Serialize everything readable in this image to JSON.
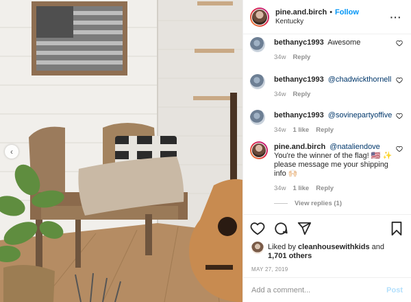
{
  "header": {
    "username": "pine.and.birch",
    "separator": "•",
    "follow_label": "Follow",
    "location": "Kentucky",
    "more_icon": "more-horizontal-icon"
  },
  "photo": {
    "prev_icon": "chevron-left-icon"
  },
  "comments": [
    {
      "username": "bethanyc1993",
      "text": "Awesome",
      "mention": "",
      "time": "34w",
      "likes": "",
      "reply": "Reply"
    },
    {
      "username": "bethanyc1993",
      "text": "",
      "mention": "@chadwickthornell",
      "time": "34w",
      "likes": "",
      "reply": "Reply"
    },
    {
      "username": "bethanyc1993",
      "text": "",
      "mention": "@sovinepartyoffive",
      "time": "34w",
      "likes": "1 like",
      "reply": "Reply"
    },
    {
      "username": "pine.and.birch",
      "mention": "@nataliendove",
      "text": "You're the winner of the flag! 🇺🇸 ✨ please message me your shipping info 🙌🏻",
      "time": "34w",
      "likes": "1 like",
      "reply": "Reply"
    }
  ],
  "view_replies": "View replies (1)",
  "actions": {
    "like_icon": "heart-icon",
    "comment_icon": "comment-icon",
    "share_icon": "send-icon",
    "save_icon": "bookmark-icon"
  },
  "likes": {
    "prefix": "Liked by",
    "user": "cleanhousewithkids",
    "and": "and",
    "count": "1,701 others"
  },
  "date": "MAY 27, 2019",
  "add_comment": {
    "placeholder": "Add a comment...",
    "post_label": "Post"
  }
}
